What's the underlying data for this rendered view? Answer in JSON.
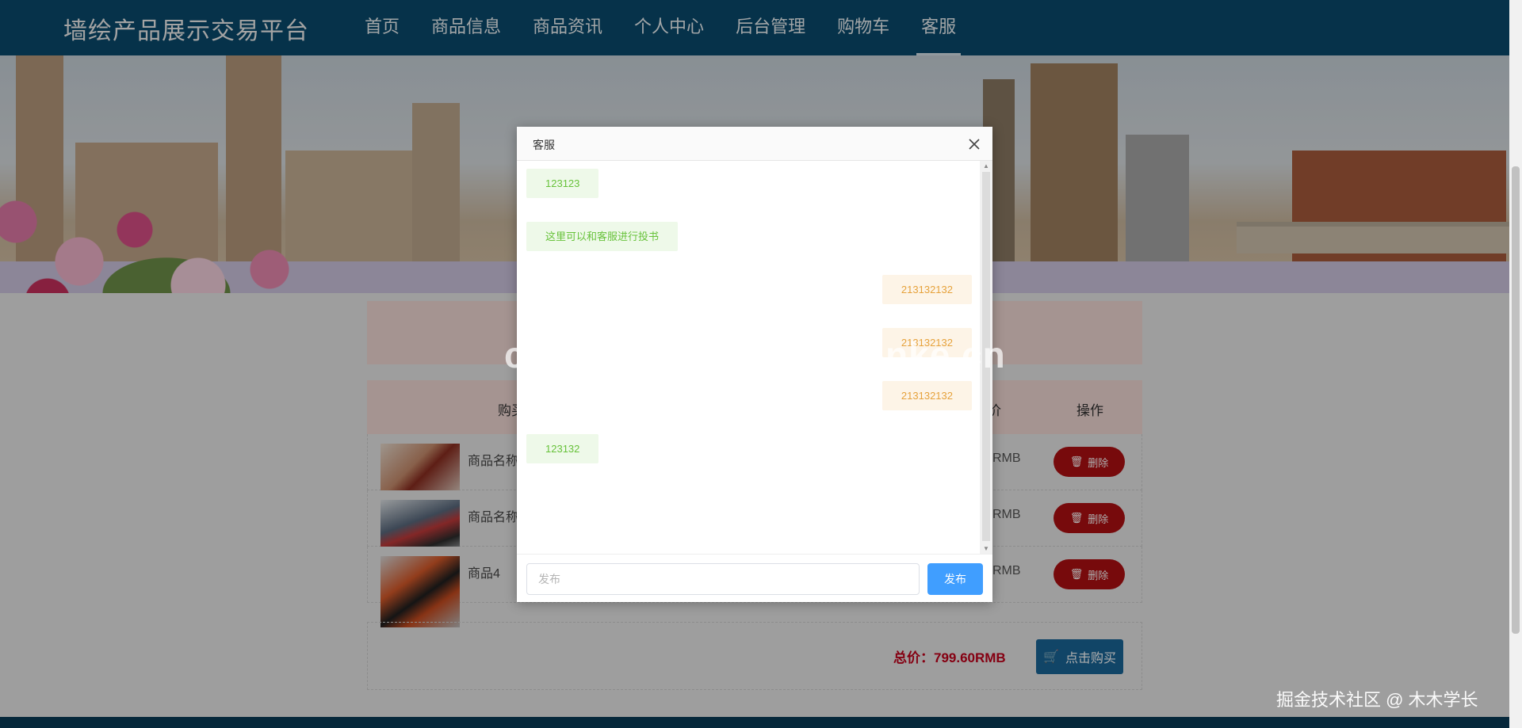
{
  "nav": {
    "brand": "墙绘产品展示交易平台",
    "items": [
      {
        "label": "首页"
      },
      {
        "label": "商品信息"
      },
      {
        "label": "商品资讯"
      },
      {
        "label": "个人中心"
      },
      {
        "label": "后台管理"
      },
      {
        "label": "购物车"
      },
      {
        "label": "客服"
      }
    ],
    "active": "客服"
  },
  "cart": {
    "headers": {
      "buy": "购买",
      "price": "价",
      "action": "操作"
    },
    "rows": [
      {
        "name": "商品名称",
        "price": "RMB",
        "delete_label": "删除"
      },
      {
        "name": "商品名称",
        "price": "RMB",
        "delete_label": "删除"
      },
      {
        "name": "商品4",
        "price": "RMB",
        "delete_label": "删除"
      }
    ],
    "total": "总价：799.60RMB",
    "buy_label": "点击购买"
  },
  "dialog": {
    "title": "客服",
    "messages": [
      {
        "side": "left",
        "text": "123123"
      },
      {
        "side": "left",
        "text": "这里可以和客服进行投书"
      },
      {
        "side": "right",
        "text": "213132132"
      },
      {
        "side": "right",
        "text": "213132132"
      },
      {
        "side": "right",
        "text": "213132132"
      },
      {
        "side": "left",
        "text": "123132"
      }
    ],
    "input_placeholder": "发布",
    "send_label": "发布"
  },
  "watermark": "cn围观客www.weiguanke.cn",
  "credit": "掘金技术社区 @ 木木学长",
  "colors": {
    "nav_bg": "#0a4b6d",
    "delete_red": "#b00f12",
    "total_red": "#c4001b",
    "send_blue": "#409eff",
    "buy_blue": "#1a6699"
  }
}
